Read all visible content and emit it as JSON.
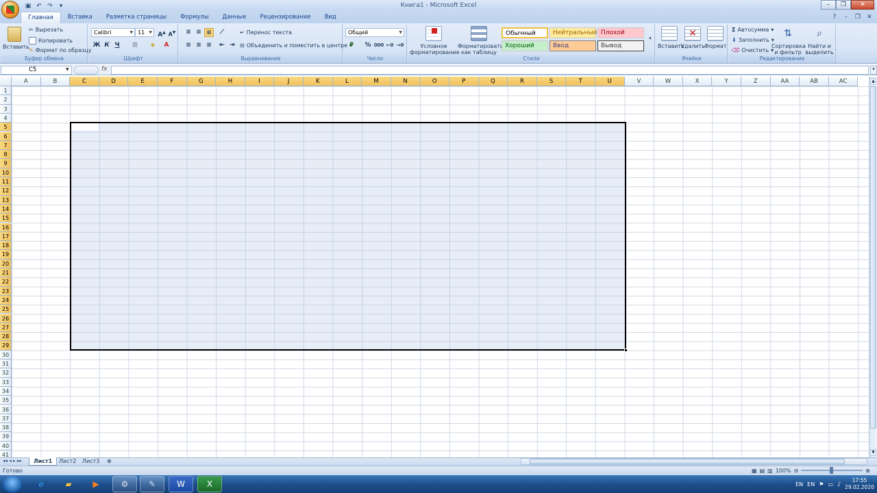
{
  "window": {
    "title": "Книга1 - Microsoft Excel"
  },
  "tabs": [
    "Главная",
    "Вставка",
    "Разметка страницы",
    "Формулы",
    "Данные",
    "Рецензирование",
    "Вид"
  ],
  "clipboard": {
    "paste": "Вставить",
    "cut": "Вырезать",
    "copy": "Копировать",
    "format_painter": "Формат по образцу",
    "label": "Буфер обмена"
  },
  "font": {
    "name": "Calibri",
    "size": "11",
    "bold": "Ж",
    "italic": "К",
    "underline": "Ч",
    "label": "Шрифт"
  },
  "alignment": {
    "wrap": "Перенос текста",
    "merge": "Объединить и поместить в центре",
    "label": "Выравнивание"
  },
  "number": {
    "format": "Общий",
    "percent": "%",
    "thousands": "000",
    "label": "Число"
  },
  "styles": {
    "conditional": "Условное форматирование",
    "as_table": "Форматировать как таблицу",
    "normal": "Обычный",
    "neutral": "Нейтральный",
    "bad": "Плохой",
    "good": "Хороший",
    "input": "Ввод",
    "output": "Вывод",
    "label": "Стили"
  },
  "cells_group": {
    "insert": "Вставить",
    "delete": "Удалить",
    "format": "Формат",
    "label": "Ячейки"
  },
  "editing": {
    "autosum": "Автосумма",
    "fill": "Заполнить",
    "clear": "Очистить",
    "sort": "Сортировка и фильтр",
    "find": "Найти и выделить",
    "label": "Редактирование"
  },
  "formula_bar": {
    "name_box": "C5",
    "fx": "fx",
    "value": ""
  },
  "columns": [
    "A",
    "B",
    "C",
    "D",
    "E",
    "F",
    "G",
    "H",
    "I",
    "J",
    "K",
    "L",
    "M",
    "N",
    "O",
    "P",
    "Q",
    "R",
    "S",
    "T",
    "U",
    "V",
    "W",
    "X",
    "Y",
    "Z",
    "AA",
    "AB",
    "AC"
  ],
  "selected_columns": [
    "C",
    "D",
    "E",
    "F",
    "G",
    "H",
    "I",
    "J",
    "K",
    "L",
    "M",
    "N",
    "O",
    "P",
    "Q",
    "R",
    "S",
    "T",
    "U"
  ],
  "row_start": 1,
  "row_end": 41,
  "selected_rows": [
    5,
    29
  ],
  "sheets": [
    "Лист1",
    "Лист2",
    "Лист3"
  ],
  "active_sheet": "Лист1",
  "status": {
    "ready": "Готово",
    "zoom": "100%"
  },
  "tray": {
    "lang1": "EN",
    "lang2": "EN",
    "time": "17:55",
    "date": "29.02.2020"
  }
}
